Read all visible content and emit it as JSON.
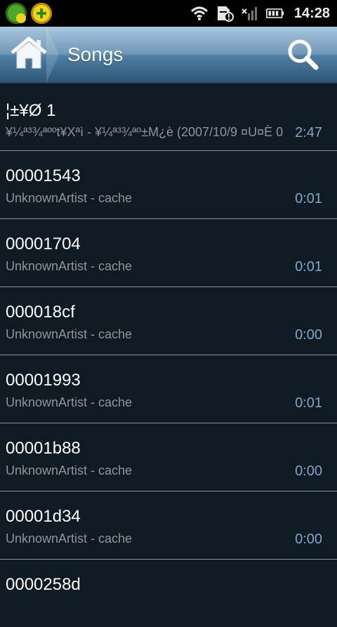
{
  "status_bar": {
    "time": "14:28",
    "icons": [
      "security-shield-app-icon",
      "plus-app-icon",
      "wifi-icon",
      "sd-card-warning-icon",
      "no-signal-icon",
      "battery-icon"
    ]
  },
  "header": {
    "title": "Songs",
    "home_icon": "home-icon",
    "search_icon": "search-icon"
  },
  "songs": [
    {
      "title": "¦±¥Ø 1",
      "subtitle": "¥¼ª³¾ªººt¥Xªì - ¥¼ª³¾ªº±M¿è (2007/10/9 ¤U¤È 0",
      "duration": "2:47"
    },
    {
      "title": "00001543",
      "subtitle": "UnknownArtist - cache",
      "duration": "0:01"
    },
    {
      "title": "00001704",
      "subtitle": "UnknownArtist - cache",
      "duration": "0:01"
    },
    {
      "title": "000018cf",
      "subtitle": "UnknownArtist - cache",
      "duration": "0:00"
    },
    {
      "title": "00001993",
      "subtitle": "UnknownArtist - cache",
      "duration": "0:01"
    },
    {
      "title": "00001b88",
      "subtitle": "UnknownArtist - cache",
      "duration": "0:00"
    },
    {
      "title": "00001d34",
      "subtitle": "UnknownArtist - cache",
      "duration": "0:00"
    },
    {
      "title": "0000258d",
      "subtitle": "",
      "duration": ""
    }
  ],
  "colors": {
    "background": "#0f1a22",
    "title_bar_top": "#a9c6dd",
    "title_bar_bottom": "#2d5575",
    "duration": "#7ea6c9",
    "subtitle": "#8f969b"
  }
}
